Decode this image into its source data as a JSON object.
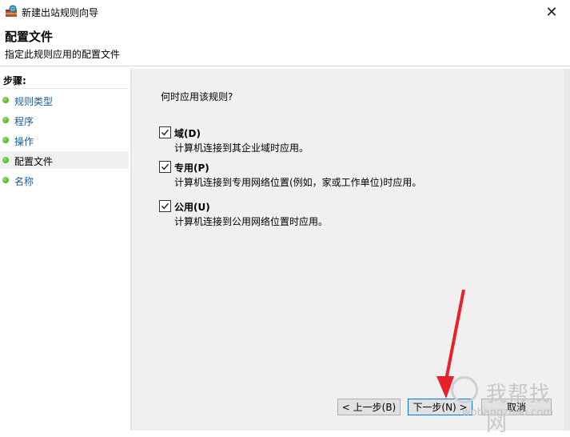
{
  "window": {
    "title": "新建出站规则向导",
    "close_glyph": "✕"
  },
  "header": {
    "title": "配置文件",
    "subtitle": "指定此规则应用的配置文件"
  },
  "sidebar": {
    "heading": "步骤:",
    "items": [
      {
        "label": "规则类型",
        "current": false
      },
      {
        "label": "程序",
        "current": false
      },
      {
        "label": "操作",
        "current": false
      },
      {
        "label": "配置文件",
        "current": true
      },
      {
        "label": "名称",
        "current": false
      }
    ]
  },
  "main": {
    "question": "何时应用该规则?",
    "options": [
      {
        "title": "域(D)",
        "desc": "计算机连接到其企业域时应用。",
        "checked": true
      },
      {
        "title": "专用(P)",
        "desc": "计算机连接到专用网络位置(例如，家或工作单位)时应用。",
        "checked": true
      },
      {
        "title": "公用(U)",
        "desc": "计算机连接到公用网络位置时应用。",
        "checked": true
      }
    ]
  },
  "buttons": {
    "back": "< 上一步(B)",
    "next": "下一步(N) >",
    "cancel": "取消"
  },
  "watermark": {
    "main": "我帮找网",
    "sub": "wobangzhao.com"
  },
  "colors": {
    "accent": "#0078d7",
    "annotation_arrow": "#e8202a",
    "step_dot": "#3aa81a"
  }
}
